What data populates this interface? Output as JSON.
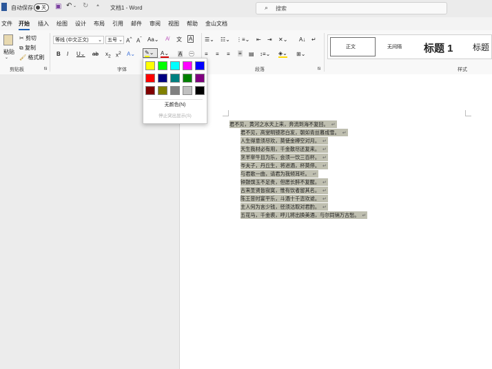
{
  "titlebar": {
    "autosave_label": "自动保存",
    "autosave_state": "关",
    "doc_title": "文档1 - Word",
    "search_placeholder": "搜索"
  },
  "menu": [
    "文件",
    "开始",
    "插入",
    "绘图",
    "设计",
    "布局",
    "引用",
    "邮件",
    "审阅",
    "视图",
    "帮助",
    "金山文档"
  ],
  "ribbon": {
    "clipboard": {
      "paste": "粘贴",
      "cut": "剪切",
      "copy": "复制",
      "format_painter": "格式刷",
      "group": "剪贴板"
    },
    "font": {
      "font_name": "等线 (中文正文)",
      "font_size": "五号",
      "group": "字体"
    },
    "paragraph": {
      "group": "段落"
    },
    "styles": {
      "items": [
        "正文",
        "无间隔",
        "标题 1",
        "标题"
      ],
      "group": "样式"
    }
  },
  "palette": {
    "colors": [
      [
        "#ffff00",
        "#00ff00",
        "#00ffff",
        "#ff00ff",
        "#0000ff"
      ],
      [
        "#ff0000",
        "#000080",
        "#008080",
        "#008000",
        "#800080"
      ],
      [
        "#800000",
        "#808000",
        "#808080",
        "#c0c0c0",
        "#000000"
      ]
    ],
    "no_color": "无颜色(N)",
    "stop": "停止突出显示(S)"
  },
  "document": {
    "lines": [
      "君不见，黄河之水天上来，奔流到海不复回。",
      "君不见，高堂明镜悲白发，朝如青丝暮成雪。",
      "人生得意须尽欢，莫使金樽空对月。",
      "天生我材必有用，千金散尽还复来。",
      "烹羊宰牛且为乐，会须一饮三百杯。",
      "岑夫子，丹丘生，将进酒，杯莫停。",
      "与君歌一曲，请君为我倾耳听。",
      "钟鼓馔玉不足贵，但愿长醉不复醒。",
      "古来圣贤皆寂寞，惟有饮者留其名。",
      "陈王昔时宴平乐，斗酒十千恣欢谑。",
      "主人何为言少钱，径须沽取对君酌。",
      "五花马，千金裘，呼儿将出换美酒，与尔同销万古愁。"
    ]
  }
}
